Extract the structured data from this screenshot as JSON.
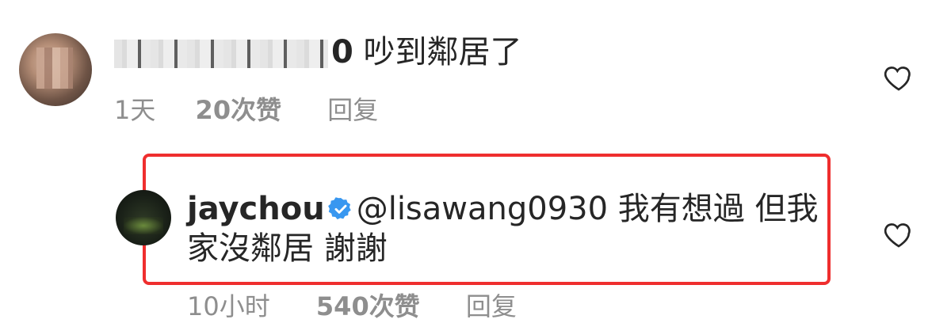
{
  "comments": [
    {
      "username": "",
      "username_suffix": "0",
      "text": "吵到鄰居了",
      "time": "1天",
      "likes": "20次赞",
      "reply": "回复"
    },
    {
      "username": "jaychou",
      "mention": "@lisawang0930",
      "text_line1": "我有想過 但我",
      "text_line2": "家沒鄰居 謝謝",
      "time": "10小时",
      "likes": "540次赞",
      "reply": "回复"
    }
  ],
  "icons": {
    "like": "heart-outline-icon",
    "verified": "verified-badge-icon"
  },
  "colors": {
    "highlight_border": "#ef2e2e",
    "meta_text": "#8e8e8e",
    "verified_blue": "#3897f0"
  }
}
